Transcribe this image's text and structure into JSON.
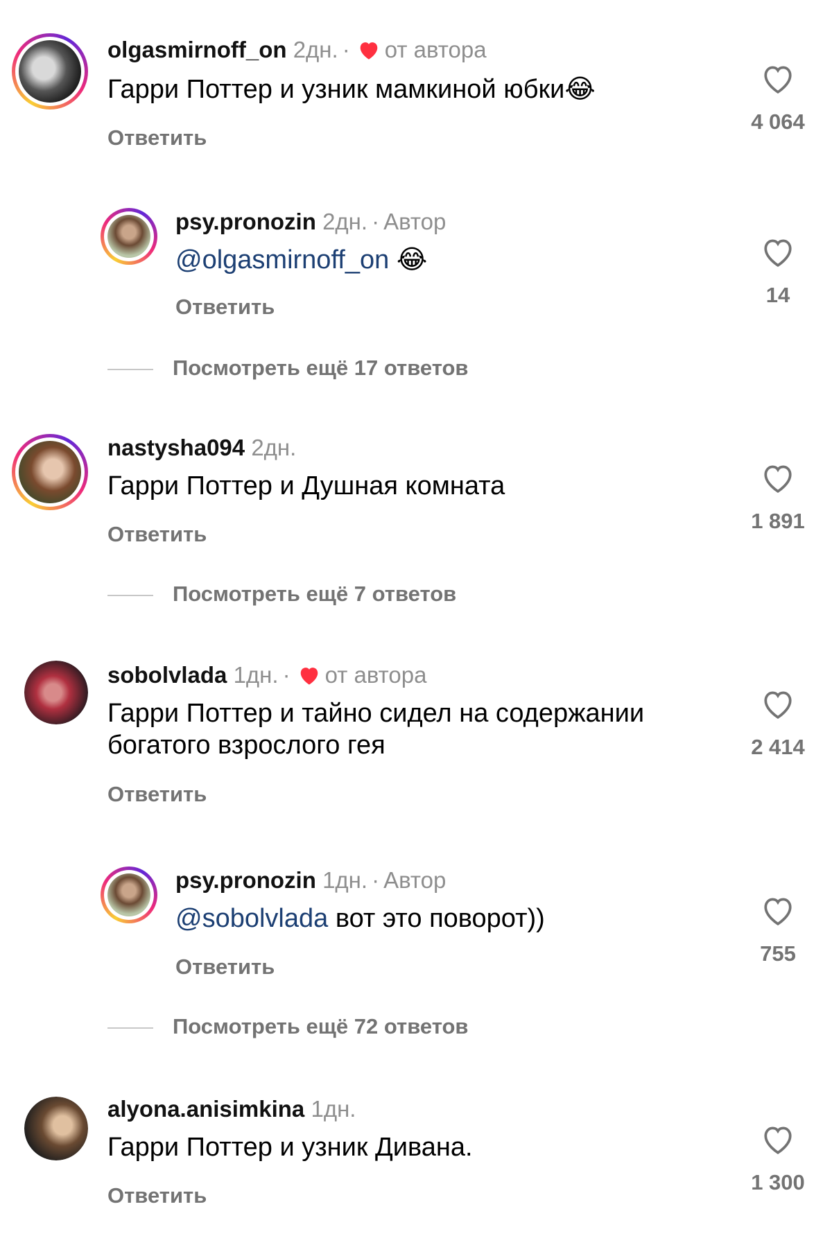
{
  "comments": [
    {
      "user": "olgasmirnoff_on",
      "time": "2дн.",
      "badge": "от автора",
      "text": "Гарри Поттер и узник мамкиной юбки",
      "emoji": "😂",
      "reply": "Ответить",
      "likes": "4 064"
    },
    {
      "user": "psy.pronozin",
      "time": "2дн.",
      "author": "Автор",
      "mention": "@olgasmirnoff_on",
      "emoji": "😂",
      "reply": "Ответить",
      "likes": "14"
    },
    {
      "more": "Посмотреть ещё 17 ответов"
    },
    {
      "user": "nastysha094",
      "time": "2дн.",
      "text": "Гарри Поттер и Душная комната",
      "reply": "Ответить",
      "likes": "1 891"
    },
    {
      "more": "Посмотреть ещё 7 ответов"
    },
    {
      "user": "sobolvlada",
      "time": "1дн.",
      "badge": "от автора",
      "text": "Гарри Поттер и тайно сидел на содержании богатого взрослого гея",
      "reply": "Ответить",
      "likes": "2 414"
    },
    {
      "user": "psy.pronozin",
      "time": "1дн.",
      "author": "Автор",
      "mention": "@sobolvlada",
      "text": " вот это поворот))",
      "reply": "Ответить",
      "likes": "755"
    },
    {
      "more": "Посмотреть ещё 72 ответов"
    },
    {
      "user": "alyona.anisimkina",
      "time": "1дн.",
      "text": "Гарри Поттер и узник Дивана.",
      "reply": "Ответить",
      "likes": "1 300"
    }
  ],
  "separator_dot": "·",
  "colors": {
    "heart_red": "#ff3040",
    "mention": "#1c3f73",
    "muted": "#737373"
  }
}
